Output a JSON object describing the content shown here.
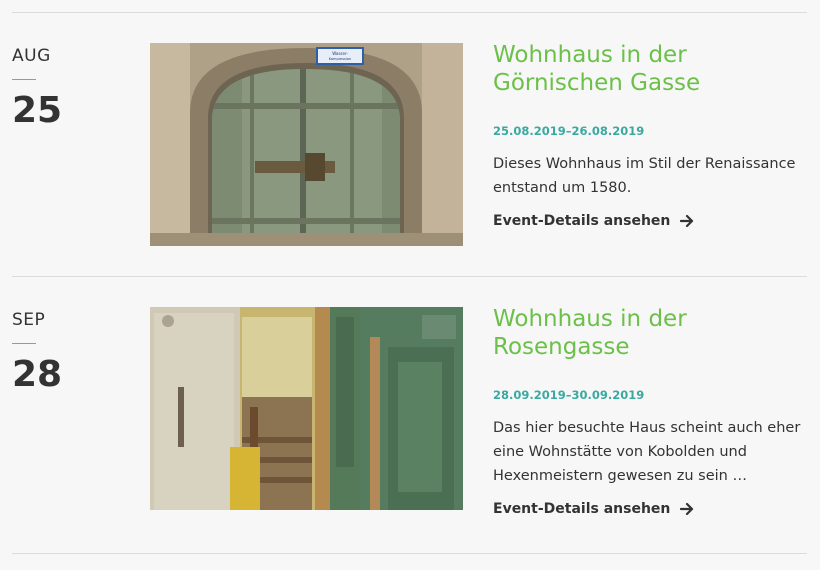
{
  "events": [
    {
      "month": "AUG",
      "day": "25",
      "title": "Wohnhaus in der Görnischen Gasse",
      "date_range": "25.08.2019–26.08.2019",
      "description": "Dieses Wohnhaus im Stil der Renaissance entstand um 1580.",
      "link_label": "Event-Details ansehen",
      "image_subject": "old wooden door in stone arch",
      "sign_text": "Wasser-Kompressionsventil\nNur im Notfall"
    },
    {
      "month": "SEP",
      "day": "28",
      "title": "Wohnhaus in der Rosengasse",
      "date_range": "28.09.2019–30.09.2019",
      "description": "Das hier besuchte Haus scheint auch eher eine Wohnstätte von Kobolden und Hexenmeistern gewesen zu sein …",
      "link_label": "Event-Details ansehen",
      "image_subject": "old staircase interior with green doors"
    }
  ],
  "colors": {
    "title": "#6cc04a",
    "date_range": "#3aa9a0",
    "text": "#333333",
    "divider": "#dcdcdc"
  },
  "icons": {
    "link_arrow": "arrow-right-icon"
  }
}
